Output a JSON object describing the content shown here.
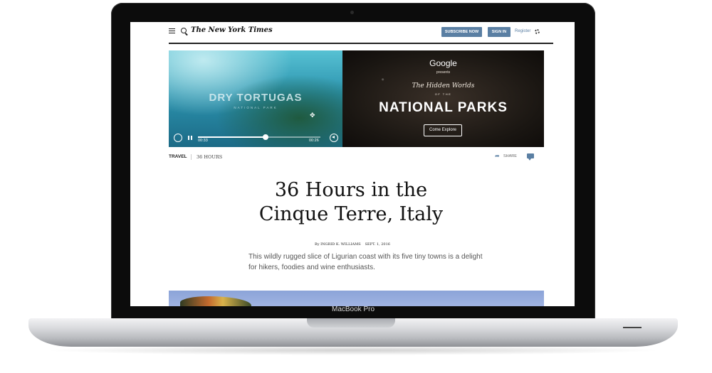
{
  "device": {
    "brand_label": "MacBook Pro"
  },
  "header": {
    "logo": "The New York Times",
    "subscribe_label": "SUBSCRIBE NOW",
    "signin_label": "SIGN IN",
    "register_label": "Register"
  },
  "video": {
    "title": "DRY TORTUGAS",
    "subtitle": "NATIONAL PARK",
    "current_time": "00:33",
    "end_time": "00:26",
    "progress": 0.55
  },
  "promo": {
    "brand": "Google",
    "presents": "presents",
    "hidden_worlds": "The Hidden Worlds",
    "of_the": "OF THE",
    "title": "NATIONAL PARKS",
    "cta_label": "Come Explore"
  },
  "article": {
    "section": "TRAVEL",
    "subsection": "36 HOURS",
    "share_label": "SHARE",
    "headline_line1": "36 Hours in the",
    "headline_line2": "Cinque Terre, Italy",
    "byline": "By INGRID K. WILLIAMS",
    "date": "SEPT. 1, 2016",
    "summary": "This wildly rugged slice of Ligurian coast with its five tiny towns is a delight for hikers, foodies and wine enthusiasts."
  },
  "colors": {
    "accent": "#5a7fa3"
  }
}
